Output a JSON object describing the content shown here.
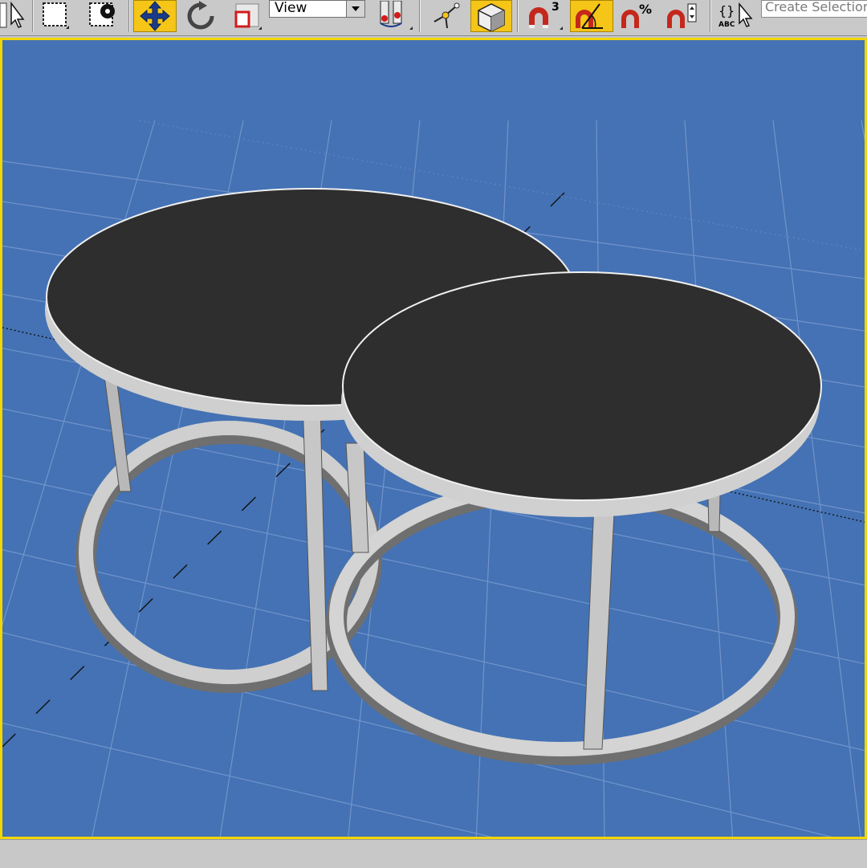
{
  "toolbar": {
    "tools": [
      {
        "name": "select-object-icon",
        "active": false
      },
      {
        "name": "select-region-icon",
        "active": false
      },
      {
        "name": "select-by-name-icon",
        "active": false
      },
      {
        "name": "move-icon",
        "active": true
      },
      {
        "name": "rotate-icon",
        "active": false
      },
      {
        "name": "scale-icon",
        "active": false
      },
      {
        "name": "use-pivot-icon",
        "active": false
      },
      {
        "name": "manipulate-icon",
        "active": false
      },
      {
        "name": "keyboard-shortcut-icon",
        "active": true
      },
      {
        "name": "snap-3d-icon",
        "active": false
      },
      {
        "name": "angle-snap-icon",
        "active": true
      },
      {
        "name": "percent-snap-icon",
        "active": false
      },
      {
        "name": "spinner-snap-icon",
        "active": false
      },
      {
        "name": "edit-named-selection-icon",
        "active": false
      }
    ],
    "reference_coordinate_system": "View",
    "snap_3d_label": "3",
    "named_selection_glyph": "{}",
    "named_selection_abc": "ABC",
    "named_selection_set_placeholder": "Create Selection Set"
  },
  "viewport": {
    "background_color": "#4472b4",
    "grid_color": "#7a9bd0",
    "table_top_color": "#2e2e2e",
    "table_frame_color": "#c9c9c9",
    "active_border_color": "#f2d600"
  }
}
